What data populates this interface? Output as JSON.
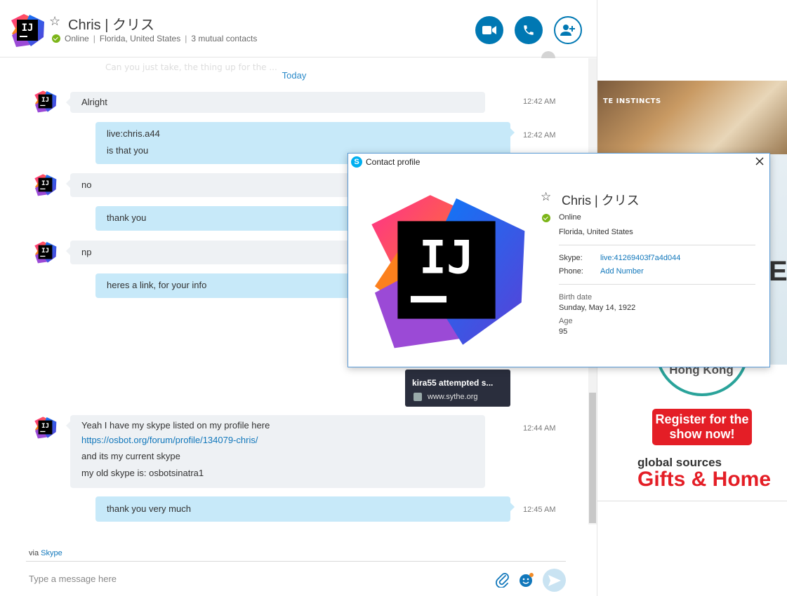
{
  "header": {
    "name": "Chris | クリス",
    "status": "Online",
    "location": "Florida, United States",
    "mutual": "3 mutual contacts",
    "separator": "|"
  },
  "chat": {
    "date_separator": "Today",
    "faded_text": "Can you just take, the thing up for the ...",
    "messages": [
      {
        "dir": "in",
        "lines": [
          "Alright"
        ],
        "time": "12:42 AM"
      },
      {
        "dir": "out",
        "lines": [
          "live:chris.a44",
          "is that you"
        ],
        "time": "12:42 AM"
      },
      {
        "dir": "in",
        "lines": [
          "no"
        ]
      },
      {
        "dir": "out",
        "lines": [
          "thank you"
        ]
      },
      {
        "dir": "in",
        "lines": [
          "np"
        ]
      },
      {
        "dir": "out",
        "lines": [
          "heres a link, for your info"
        ]
      },
      {
        "dir": "in",
        "lines": [
          "Yeah I have my skype listed on my profile here",
          "https://osbot.org/forum/profile/134079-chris/",
          "and its my current skype",
          "my old skype is: osbotsinatra1"
        ],
        "time": "12:44 AM"
      },
      {
        "dir": "out",
        "lines": [
          "thank you very much"
        ],
        "time": "12:45 AM"
      }
    ],
    "link_card": {
      "title": "kira55 attempted s...",
      "url": "www.sythe.org"
    }
  },
  "composer": {
    "via_prefix": "via",
    "via_link": "Skype",
    "placeholder": "Type a message here"
  },
  "ad": {
    "top_text": "TE INSTINCTS",
    "big_letter": "E",
    "city": "Hong Kong",
    "register": "Register for the show now!",
    "brand": "global sources",
    "tagline": "Gifts & Home"
  },
  "profile_dialog": {
    "title": "Contact profile",
    "name": "Chris | クリス",
    "status": "Online",
    "location": "Florida, United States",
    "skype_label": "Skype:",
    "skype_value": "live:41269403f7a4d044",
    "phone_label": "Phone:",
    "phone_value": "Add Number",
    "birth_label": "Birth date",
    "birth_value": "Sunday, May 14, 1922",
    "age_label": "Age",
    "age_value": "95"
  },
  "colors": {
    "accent": "#0078b3",
    "incoming_bubble": "#eef1f4",
    "outgoing_bubble": "#c7e9f9",
    "online": "#7cb518",
    "link": "#1177bb"
  },
  "icons": [
    "star-icon",
    "video-call-icon",
    "phone-icon",
    "add-contact-icon",
    "globe-icon",
    "paperclip-icon",
    "emoji-icon",
    "send-icon",
    "skype-icon",
    "close-icon"
  ]
}
